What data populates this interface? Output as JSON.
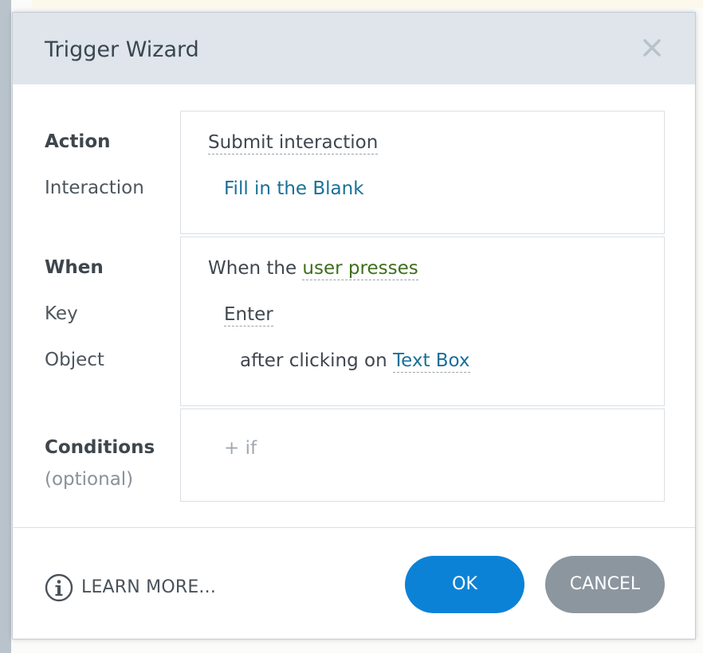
{
  "dialog": {
    "title": "Trigger Wizard",
    "close_icon": "close-icon"
  },
  "action_section": {
    "label": "Action",
    "sub_label": "Interaction",
    "action_value": "Submit interaction",
    "interaction_value": "Fill in the Blank"
  },
  "when_section": {
    "label": "When",
    "key_label": "Key",
    "object_label": "Object",
    "when_prefix": "When the",
    "when_value": "user presses",
    "key_value": "Enter",
    "object_prefix": "after clicking on",
    "object_value": "Text Box"
  },
  "conditions_section": {
    "label": "Conditions",
    "sub_label": "(optional)",
    "add_condition": "+ if"
  },
  "footer": {
    "info_icon": "info-icon",
    "learn_more": "LEARN MORE...",
    "ok_label": "OK",
    "cancel_label": "CANCEL"
  },
  "colors": {
    "header_bg": "#dfe5ea",
    "ok_button": "#0c82d7",
    "cancel_button": "#8b969f",
    "link_blue": "#18709a",
    "link_green": "#3e6f1c"
  }
}
